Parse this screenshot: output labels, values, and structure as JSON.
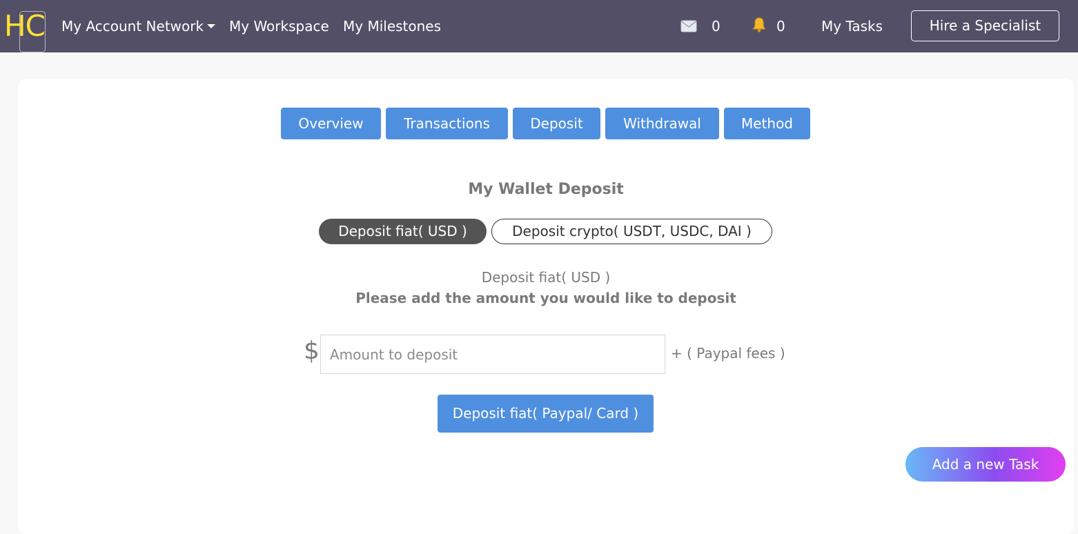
{
  "navbar": {
    "logo_text": "HC",
    "links": {
      "account_network": "My Account Network",
      "workspace": "My Workspace",
      "milestones": "My Milestones",
      "tasks": "My Tasks"
    },
    "messages": {
      "icon": "envelope-icon",
      "count": "0"
    },
    "notifications": {
      "icon": "bell-icon",
      "count": "0"
    },
    "hire_button": "Hire a Specialist"
  },
  "tabs": [
    "Overview",
    "Transactions",
    "Deposit",
    "Withdrawal",
    "Method"
  ],
  "wallet": {
    "title": "My Wallet Deposit",
    "pill_fiat": "Deposit fiat( USD )",
    "pill_crypto": "Deposit crypto( USDT, USDC, DAI )",
    "section_title": "Deposit fiat( USD )",
    "instruction": "Please add the amount you would like to deposit",
    "currency_symbol": "$",
    "amount_placeholder": "Amount to deposit",
    "fee_note": "+ ( Paypal fees )",
    "deposit_button": "Deposit fiat( Paypal/ Card )"
  },
  "add_task_button": "Add a new Task",
  "colors": {
    "navbar": "#534f66",
    "accent": "#4f8fe0",
    "logo": "#ffe135",
    "pill_active": "#545454"
  }
}
